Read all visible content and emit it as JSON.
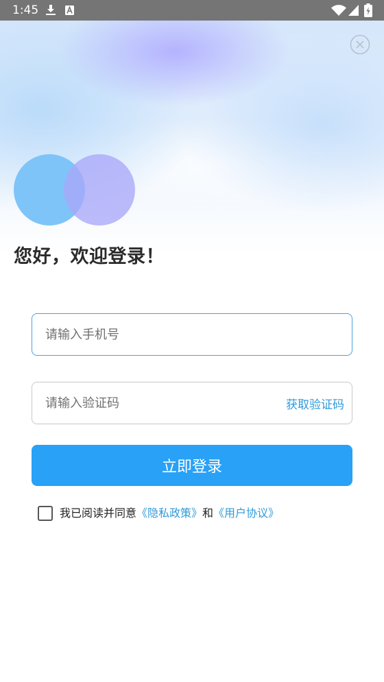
{
  "status_bar": {
    "time": "1:45",
    "left_icons": [
      "download-icon",
      "a-notification-icon"
    ],
    "right_icons": [
      "wifi-icon",
      "signal-icon",
      "battery-charging-icon"
    ]
  },
  "header": {
    "close_icon": "close-circle-icon"
  },
  "logo": {
    "icons": [
      "logo-circle-blue",
      "logo-circle-purple"
    ]
  },
  "welcome": {
    "title": "您好，欢迎登录！"
  },
  "phone_field": {
    "placeholder": "请输入手机号",
    "value": ""
  },
  "code_field": {
    "placeholder": "请输入验证码",
    "value": "",
    "get_code_label": "获取验证码"
  },
  "login_button": {
    "label": "立即登录"
  },
  "agreement": {
    "checked": false,
    "prefix": "我已阅读并同意",
    "privacy_link": "《隐私政策》",
    "conjunction": "和",
    "terms_link": "《用户协议》"
  },
  "colors": {
    "accent": "#28a1f7",
    "link": "#2f9ad9",
    "focus_border": "#4aa2df",
    "status_bar": "#757575",
    "logo_blue": "#7ec4f9",
    "logo_purple": "#a9a8f9"
  }
}
